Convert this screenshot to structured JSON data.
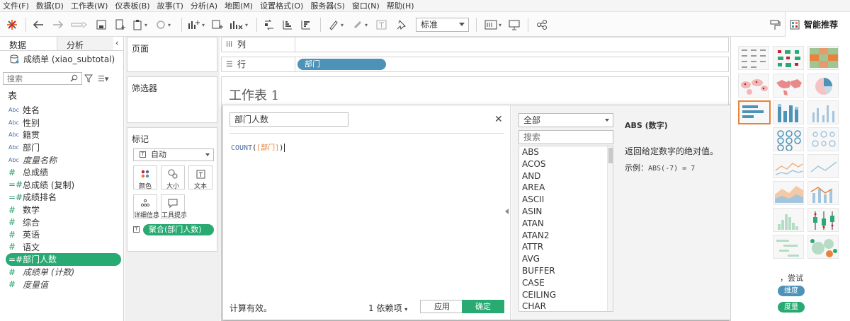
{
  "menu": [
    "文件(F)",
    "数据(D)",
    "工作表(W)",
    "仪表板(B)",
    "故事(T)",
    "分析(A)",
    "地图(M)",
    "设置格式(O)",
    "服务器(S)",
    "窗口(N)",
    "帮助(H)"
  ],
  "toolbar": {
    "fit_value": "标准",
    "show_me_label": "智能推荐"
  },
  "data_pane": {
    "tabs": [
      "数据",
      "分析"
    ],
    "datasource": "成绩单 (xiao_subtotal)",
    "search_placeholder": "搜索",
    "section_title": "表",
    "fields": [
      {
        "icon": "Abc",
        "name": "姓名",
        "type": "dim"
      },
      {
        "icon": "Abc",
        "name": "性别",
        "type": "dim"
      },
      {
        "icon": "Abc",
        "name": "籍贯",
        "type": "dim"
      },
      {
        "icon": "Abc",
        "name": "部门",
        "type": "dim"
      },
      {
        "icon": "Abc",
        "name": "度量名称",
        "type": "dim",
        "italic": true
      },
      {
        "icon": "#",
        "name": "总成绩",
        "type": "measure"
      },
      {
        "icon": "=#",
        "name": "总成绩 (复制)",
        "type": "measure"
      },
      {
        "icon": "=#",
        "name": "成绩排名",
        "type": "measure"
      },
      {
        "icon": "#",
        "name": "数学",
        "type": "measure"
      },
      {
        "icon": "#",
        "name": "综合",
        "type": "measure"
      },
      {
        "icon": "#",
        "name": "英语",
        "type": "measure"
      },
      {
        "icon": "#",
        "name": "语文",
        "type": "measure"
      },
      {
        "icon": "=#",
        "name": "部门人数",
        "type": "measure",
        "selected": true
      },
      {
        "icon": "#",
        "name": "成绩单 (计数)",
        "type": "measure",
        "italic": true
      },
      {
        "icon": "#",
        "name": "度量值",
        "type": "measure",
        "italic": true
      }
    ]
  },
  "shelves": {
    "pages": "页面",
    "filters": "筛选器",
    "marks": "标记",
    "mark_type": "自动",
    "mark_buttons": [
      "颜色",
      "大小",
      "文本",
      "详细信息",
      "工具提示"
    ],
    "mark_pill": "聚合(部门人数)",
    "columns_label": "列",
    "rows_label": "行",
    "rows_pill": "部门"
  },
  "sheet_title": "工作表 1",
  "calc": {
    "name": "部门人数",
    "formula_func": "COUNT",
    "formula_field": "[部门]",
    "status": "计算有效。",
    "dependencies": "1 依赖项",
    "apply": "应用",
    "ok": "确定",
    "category": "全部",
    "search_placeholder": "搜索",
    "functions": [
      "ABS",
      "ACOS",
      "AND",
      "AREA",
      "ASCII",
      "ASIN",
      "ATAN",
      "ATAN2",
      "ATTR",
      "AVG",
      "BUFFER",
      "CASE",
      "CEILING",
      "CHAR"
    ],
    "help_title": "ABS (数字)",
    "help_desc": "返回给定数字的绝对值。",
    "help_example_label": "示例：",
    "help_example_code": "ABS(-7) = 7"
  },
  "show_me": {
    "try_text": "，尝试",
    "dim_pill": "维度",
    "measure_pill": "度量",
    "colors": {
      "dimension": "#4c93b7",
      "measure": "#2aaa73",
      "selected": "#e8823c"
    }
  }
}
